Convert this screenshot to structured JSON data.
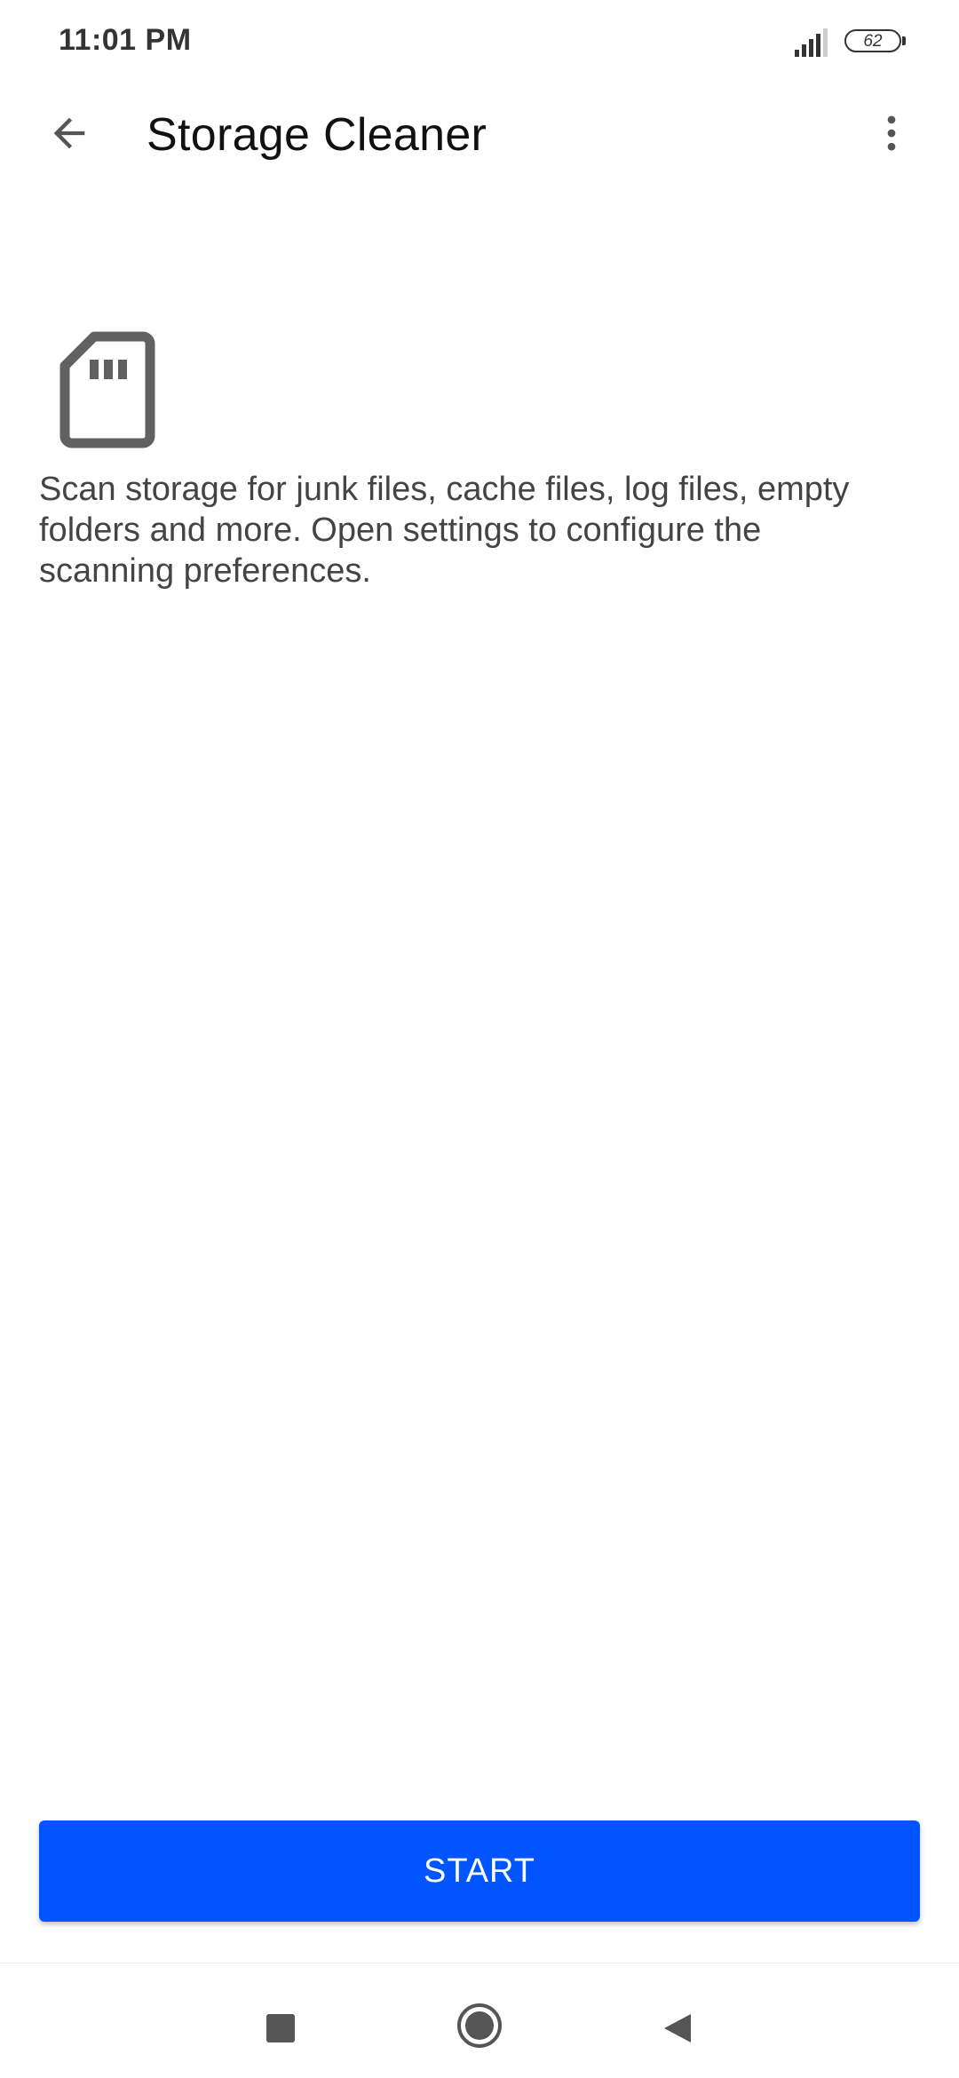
{
  "status_bar": {
    "time": "11:01 PM",
    "battery_level": "62",
    "icons": [
      "signal-icon",
      "battery-icon"
    ]
  },
  "app_bar": {
    "title": "Storage Cleaner",
    "back_icon": "arrow-back-icon",
    "menu_icon": "more-vert-icon"
  },
  "content": {
    "icon": "sd-card-icon",
    "description": "Scan storage for junk files, cache files, log files, empty folders and more. Open settings to configure the scanning preferences."
  },
  "actions": {
    "start_label": "START"
  },
  "nav_bar": {
    "icons": [
      "recents-icon",
      "home-icon",
      "back-icon"
    ]
  },
  "colors": {
    "accent": "#0055ff",
    "icon_gray": "#616161",
    "text": "#444444",
    "background": "#ffffff"
  }
}
